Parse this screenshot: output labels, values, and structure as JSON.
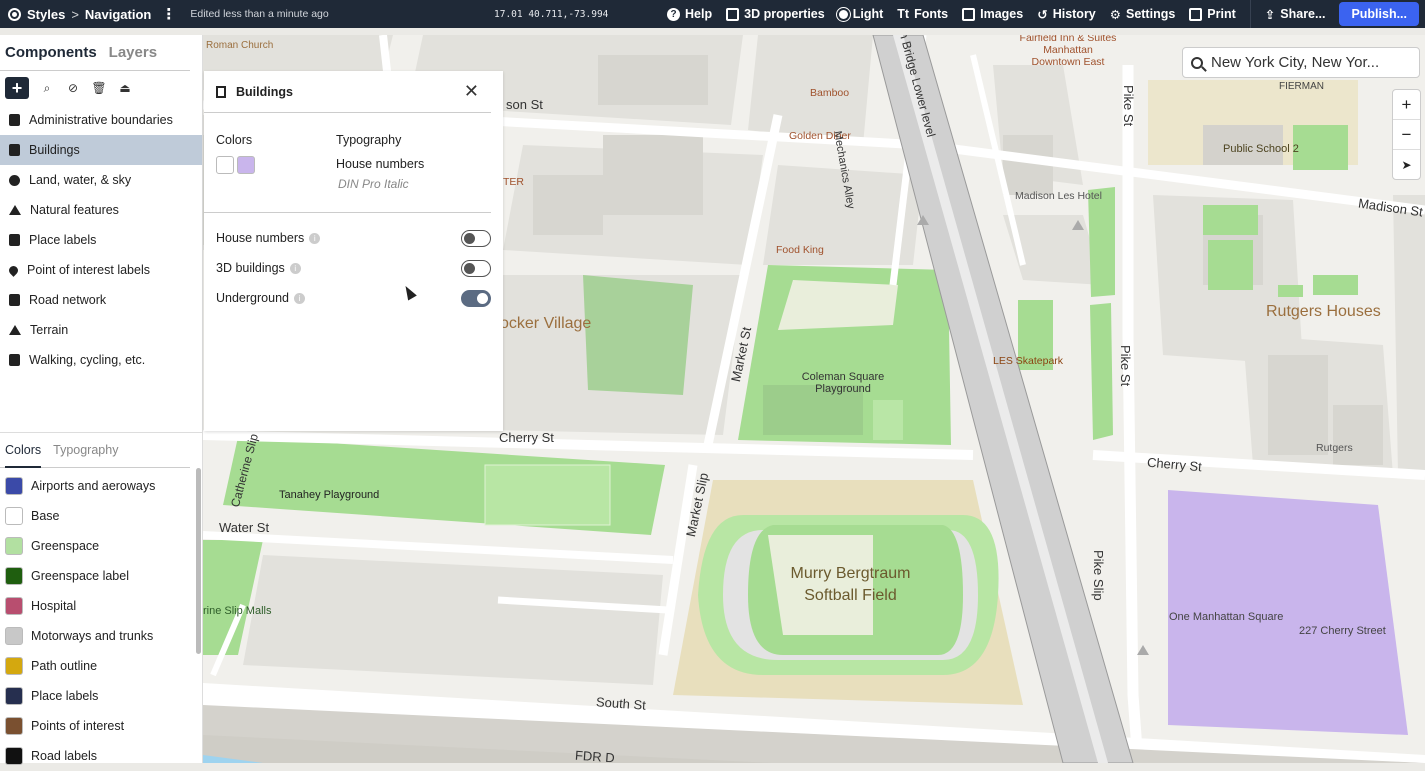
{
  "topbar": {
    "crumb_styles": "Styles",
    "crumb_sep": ">",
    "crumb_navigation": "Navigation",
    "edited": "Edited less than a minute ago",
    "coords": "17.01 40.711,-73.994",
    "items": {
      "help": "Help",
      "properties_3d": "3D properties",
      "light": "Light",
      "fonts": "Fonts",
      "images": "Images",
      "history": "History",
      "settings": "Settings",
      "print": "Print",
      "share": "Share..."
    },
    "publish": "Publish..."
  },
  "sidebar": {
    "tabs": {
      "components": "Components",
      "layers": "Layers"
    },
    "components": [
      "Administrative boundaries",
      "Buildings",
      "Land, water, & sky",
      "Natural features",
      "Place labels",
      "Point of interest labels",
      "Road network",
      "Terrain",
      "Walking, cycling, etc."
    ],
    "lower_tabs": {
      "colors": "Colors",
      "typography": "Typography"
    },
    "swatches": [
      {
        "label": "Airports and aeroways",
        "color": "#3b4aa8"
      },
      {
        "label": "Base",
        "color": "#ffffff"
      },
      {
        "label": "Greenspace",
        "color": "#b2e0a1"
      },
      {
        "label": "Greenspace label",
        "color": "#1f5e0f"
      },
      {
        "label": "Hospital",
        "color": "#b84e6f"
      },
      {
        "label": "Motorways and trunks",
        "color": "#c8c8c8"
      },
      {
        "label": "Path outline",
        "color": "#d4a80f"
      },
      {
        "label": "Place labels",
        "color": "#262f4f"
      },
      {
        "label": "Points of interest",
        "color": "#7a5030"
      },
      {
        "label": "Road labels",
        "color": "#111111"
      }
    ]
  },
  "panel": {
    "title": "Buildings",
    "colors_label": "Colors",
    "swatch_colors": [
      "#ffffff",
      "#c9b5ec"
    ],
    "typography_label": "Typography",
    "typo_item": "House numbers",
    "typo_font": "DIN Pro Italic",
    "toggles": [
      {
        "label": "House numbers",
        "on": false
      },
      {
        "label": "3D buildings",
        "on": false
      },
      {
        "label": "Underground",
        "on": true
      }
    ]
  },
  "search": {
    "value": "New York City, New Yor..."
  },
  "zoom": {
    "in": "+",
    "out": "−"
  },
  "map_labels": {
    "roman_church": "Roman Church",
    "madison_st_top": "son St",
    "bamboo": "Bamboo",
    "golden_diner": "Golden Diner",
    "food_king": "Food King",
    "ter": "TER",
    "mechanics_alley": "Mechanics Alley",
    "bridge_lower": "n Bridge Lower level",
    "fairfield": "Fairfield Inn & Suites Manhattan Downtown East",
    "fierman": "FIERMAN",
    "public_school": "Public School 2",
    "madison_les": "Madison Les Hotel",
    "madison_st_right": "Madison St",
    "pike_st_1": "Pike St",
    "pike_st_2": "Pike St",
    "pike_slip": "Pike Slip",
    "rutgers_houses": "Rutgers Houses",
    "rutgers": "Rutgers",
    "knicker": "ocker Village",
    "market_st": "Market St",
    "coleman": "Coleman Square Playground",
    "les_skatepark": "LES Skatepark",
    "cherry_st": "Cherry St",
    "cherry_st_right": "Cherry St",
    "catherine_slip": "Catherine Slip",
    "tanahey": "Tanahey Playground",
    "water_st": "Water St",
    "market_slip": "Market Slip",
    "murry": "Murry Bergtraum Softball Field",
    "one_manhattan": "One Manhattan Square",
    "cherry_227": "227 Cherry Street",
    "slip_malls": "rine Slip Malls",
    "south_st": "South St",
    "fdr": "FDR D"
  }
}
